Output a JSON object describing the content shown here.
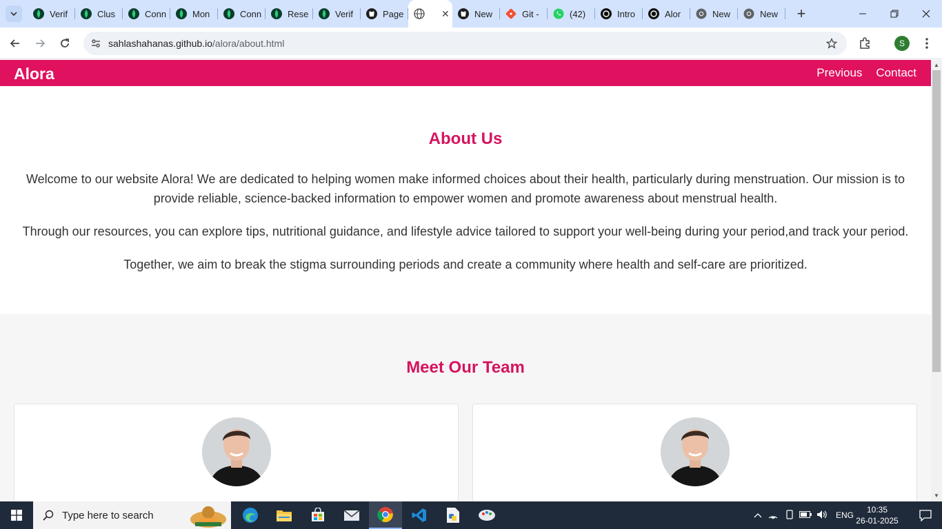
{
  "browser": {
    "tabs": [
      {
        "label": "Verif",
        "icon": "mongodb-leaf-icon"
      },
      {
        "label": "Clus",
        "icon": "mongodb-leaf-icon"
      },
      {
        "label": "Conn",
        "icon": "mongodb-leaf-icon"
      },
      {
        "label": "Mon",
        "icon": "mongodb-leaf-icon"
      },
      {
        "label": "Conn",
        "icon": "mongodb-leaf-icon"
      },
      {
        "label": "Rese",
        "icon": "mongodb-leaf-icon"
      },
      {
        "label": "Verif",
        "icon": "mongodb-leaf-icon"
      },
      {
        "label": "Page",
        "icon": "github-icon"
      },
      {
        "label": "",
        "icon": "globe-icon",
        "active": true
      },
      {
        "label": "New",
        "icon": "github-icon"
      },
      {
        "label": "Git -",
        "icon": "git-icon"
      },
      {
        "label": "(42)",
        "icon": "whatsapp-icon"
      },
      {
        "label": "Intro",
        "icon": "openai-icon"
      },
      {
        "label": "Alor",
        "icon": "openai-icon"
      },
      {
        "label": "New",
        "icon": "chrome-icon"
      },
      {
        "label": "New",
        "icon": "chrome-icon"
      }
    ],
    "url_host": "sahlashahanas.github.io",
    "url_path": "/alora/about.html",
    "profile_initial": "S"
  },
  "site": {
    "brand": "Alora",
    "nav": [
      "Previous",
      "Contact"
    ]
  },
  "about": {
    "title": "About Us",
    "p1": "Welcome to our website Alora! We are dedicated to helping women make informed choices about their health, particularly during menstruation. Our mission is to provide reliable, science-backed information to empower women and promote awareness about menstrual health.",
    "p2": "Through our resources, you can explore tips, nutritional guidance, and lifestyle advice tailored to support your well-being during your period,and track your period.",
    "p3": "Together, we aim to break the stigma surrounding periods and create a community where health and self-care are prioritized."
  },
  "team": {
    "title": "Meet Our Team"
  },
  "taskbar": {
    "search_placeholder": "Type here to search",
    "language": "ENG",
    "time": "10:35",
    "date": "26-01-2025"
  },
  "colors": {
    "brand": "#e0115f",
    "heading": "#d6135f"
  }
}
